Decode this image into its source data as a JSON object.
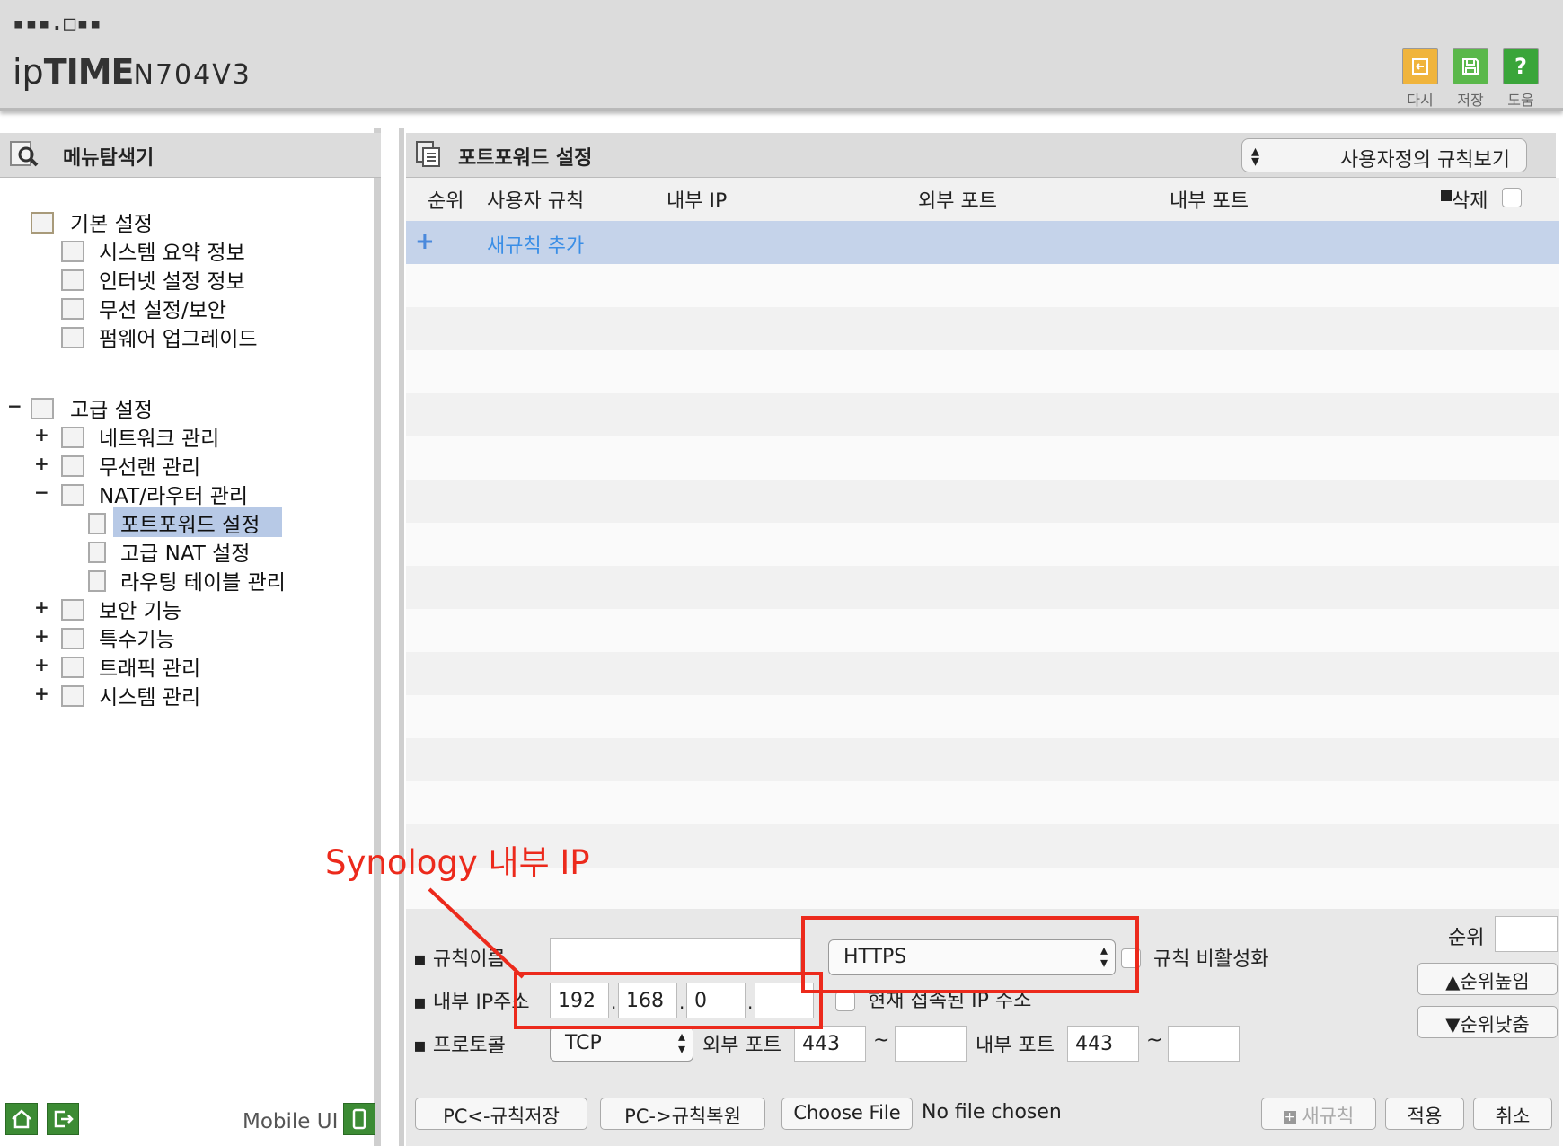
{
  "header": {
    "logo_top": "▪▪▪.□▪▪",
    "logo_prefix": "ip",
    "logo_time": "TIME",
    "logo_model": "N704V3",
    "buttons": [
      {
        "label": "다시",
        "icon": "undo-icon",
        "color": "#f0b43c"
      },
      {
        "label": "저장",
        "icon": "save-icon",
        "color": "#5ab84a"
      },
      {
        "label": "도움",
        "icon": "help-icon",
        "color": "#3aa53a"
      }
    ]
  },
  "sidebar": {
    "title": "메뉴탐색기",
    "basic": {
      "label": "기본 설정",
      "items": [
        "시스템 요약 정보",
        "인터넷 설정 정보",
        "무선 설정/보안",
        "펌웨어 업그레이드"
      ]
    },
    "advanced": {
      "toggle": "−",
      "label": "고급 설정",
      "items": [
        {
          "toggle": "+",
          "label": "네트워크 관리"
        },
        {
          "toggle": "+",
          "label": "무선랜 관리"
        },
        {
          "toggle": "−",
          "label": "NAT/라우터 관리"
        },
        {
          "toggle": "+",
          "label": "보안 기능"
        },
        {
          "toggle": "+",
          "label": "특수기능"
        },
        {
          "toggle": "+",
          "label": "트래픽 관리"
        },
        {
          "toggle": "+",
          "label": "시스템 관리"
        }
      ],
      "nat_children": [
        "포트포워드 설정",
        "고급 NAT 설정",
        "라우팅 테이블 관리"
      ]
    },
    "footer": {
      "mobile_label": "Mobile UI"
    }
  },
  "main": {
    "title": "포트포워드 설정",
    "view_select": "사용자정의 규칙보기",
    "columns": [
      "순위",
      "사용자 규칙",
      "내부 IP",
      "외부 포트",
      "내부 포트",
      "삭제"
    ],
    "add_rule": "새규칙 추가",
    "add_symbol": "+"
  },
  "form": {
    "rule_name_label": "규칙이름",
    "rule_name_value": "",
    "preset_value": "HTTPS",
    "disable_label": "규칙 비활성화",
    "internal_ip_label": "내부 IP주소",
    "ip": [
      "192",
      "168",
      "0",
      ""
    ],
    "current_ip_label": "현재 접속된 IP 주소",
    "protocol_label": "프로토콜",
    "protocol_value": "TCP",
    "external_port_label": "외부 포트",
    "external_port_from": "443",
    "external_port_to": "",
    "internal_port_label": "내부 포트",
    "internal_port_from": "443",
    "internal_port_to": "",
    "tilde": "~",
    "priority_label": "순위",
    "priority_value": "",
    "priority_up": "▲순위높임",
    "priority_down": "▼순위낮춤"
  },
  "bottom_bar": {
    "save_rules": "PC<-규칙저장",
    "restore_rules": "PC->규칙복원",
    "choose_file": "Choose File",
    "no_file": "No file chosen",
    "new_rule": "새규칙",
    "apply": "적용",
    "cancel": "취소"
  },
  "annotation": {
    "text": "Synology 내부 IP",
    "color": "#ec2a1c"
  }
}
